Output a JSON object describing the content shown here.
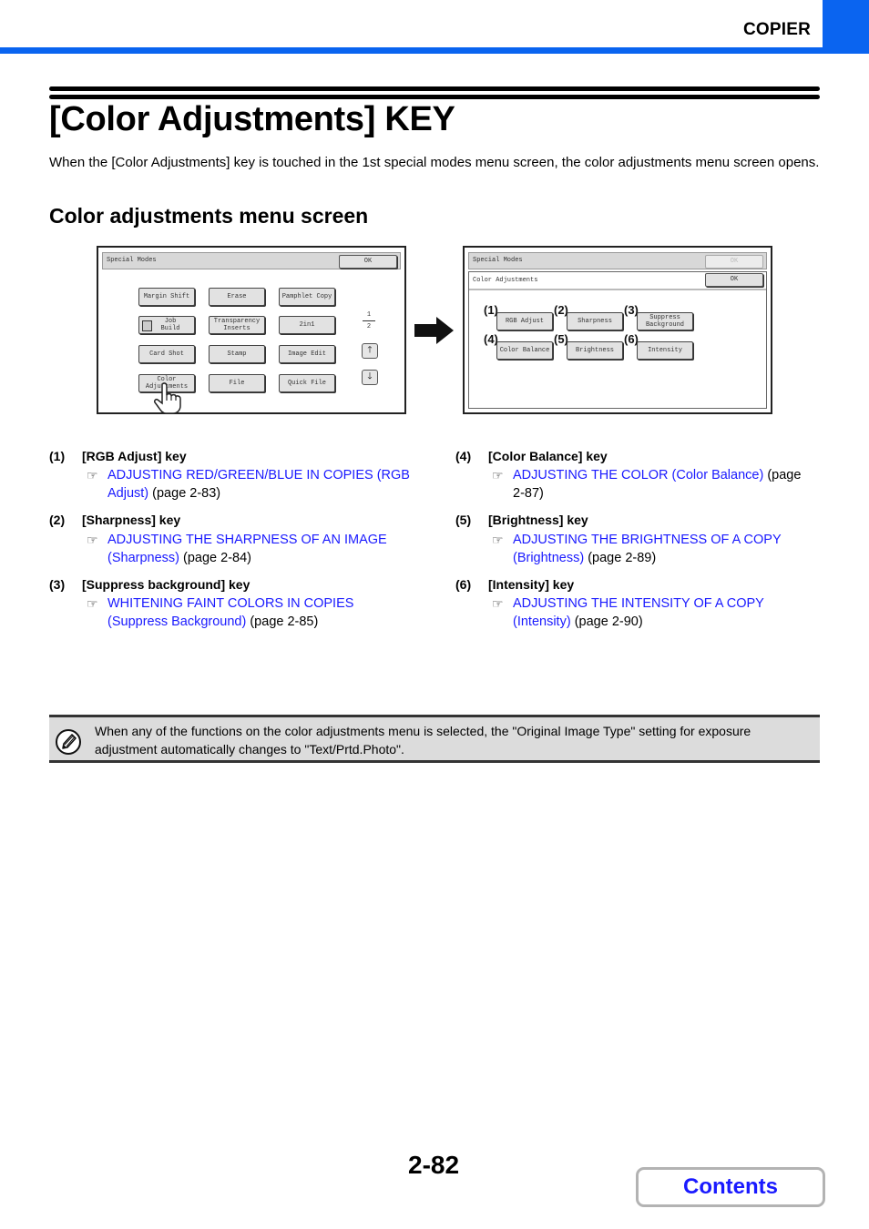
{
  "header": {
    "section": "COPIER",
    "accent_color": "#0a64f0"
  },
  "title": "[Color Adjustments] KEY",
  "intro": "When the [Color Adjustments] key is touched in the 1st special modes menu screen, the color adjustments menu screen opens.",
  "subheading": "Color adjustments menu screen",
  "screen1": {
    "bar_title": "Special Modes",
    "ok_label": "OK",
    "keys": [
      "Margin Shift",
      "Erase",
      "Pamphlet Copy",
      "Job Build",
      "Transparency Inserts",
      "2in1",
      "Card Shot",
      "Stamp",
      "Image Edit",
      "Color Adjustments",
      "File",
      "Quick File"
    ],
    "page_current": "1",
    "page_total": "2",
    "up_icon": "arrow-up",
    "down_icon": "arrow-down",
    "pointer_icon": "hand-pointer"
  },
  "transition_icon": "arrow-right",
  "screen2": {
    "bar_title": "Special Modes",
    "ok_label_disabled": "OK",
    "sub_title": "Color Adjustments",
    "ok_label": "OK",
    "keys": [
      {
        "num": "(1)",
        "label": "RGB Adjust"
      },
      {
        "num": "(2)",
        "label": "Sharpness"
      },
      {
        "num": "(3)",
        "label": "Suppress Background"
      },
      {
        "num": "(4)",
        "label": "Color Balance"
      },
      {
        "num": "(5)",
        "label": "Brightness"
      },
      {
        "num": "(6)",
        "label": "Intensity"
      }
    ]
  },
  "items": [
    {
      "num": "(1)",
      "title": "[RGB Adjust] key",
      "link": "ADJUSTING RED/GREEN/BLUE IN COPIES (RGB Adjust)",
      "page": " (page 2-83)"
    },
    {
      "num": "(2)",
      "title": "[Sharpness] key",
      "link": "ADJUSTING THE SHARPNESS OF AN IMAGE (Sharpness)",
      "page": " (page 2-84)"
    },
    {
      "num": "(3)",
      "title": "[Suppress background] key",
      "link": "WHITENING FAINT COLORS IN COPIES (Suppress Background)",
      "page": " (page 2-85)"
    },
    {
      "num": "(4)",
      "title": "[Color Balance] key",
      "link": "ADJUSTING THE COLOR (Color Balance)",
      "page": " (page 2-87)"
    },
    {
      "num": "(5)",
      "title": "[Brightness] key",
      "link": "ADJUSTING THE BRIGHTNESS OF A COPY (Brightness)",
      "page": " (page 2-89)"
    },
    {
      "num": "(6)",
      "title": "[Intensity] key",
      "link": "ADJUSTING THE INTENSITY OF A COPY (Intensity)",
      "page": " (page 2-90)"
    }
  ],
  "ref_icon": "☞",
  "note": {
    "icon": "pencil-note",
    "text": "When any of the functions on the color adjustments menu is selected, the \"Original Image Type\" setting for exposure adjustment automatically changes to \"Text/Prtd.Photo\"."
  },
  "footer": {
    "page_number": "2-82",
    "contents_label": "Contents",
    "link_color": "#1a1aff"
  }
}
